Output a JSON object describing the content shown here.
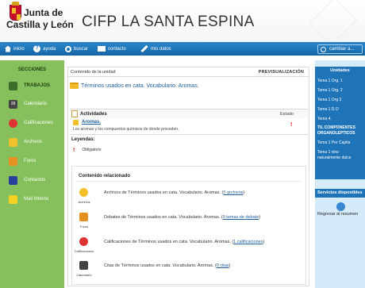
{
  "header": {
    "logo_line1": "Junta de",
    "logo_line2": "Castilla y León",
    "site_title": "CIFP LA SANTA ESPINA"
  },
  "nav": {
    "inicio": "inicio",
    "ayuda": "ayuda",
    "buscar": "buscar",
    "contacto": "contacto",
    "mis_datos": "mis datos",
    "cambiar": "cambiar a..."
  },
  "sidebar": {
    "title": "SECCIONES",
    "items": [
      {
        "label": "TRABAJOS",
        "icon": "works-icon"
      },
      {
        "label": "Calendario",
        "icon": "calendar-icon",
        "badge": "28"
      },
      {
        "label": "Calificaciones",
        "icon": "grades-icon"
      },
      {
        "label": "Archivos",
        "icon": "files-icon"
      },
      {
        "label": "Foros",
        "icon": "forums-icon"
      },
      {
        "label": "Contactos",
        "icon": "contacts-icon"
      },
      {
        "label": "Mail Interno",
        "icon": "mail-icon"
      }
    ]
  },
  "main": {
    "unit_label": "Contenido de la unidad",
    "preview_label": "PREVISUALIZACIÓN",
    "unit_title": "Términos usados en cata. Vocabulario. Aromas.",
    "activities": {
      "title": "Actividades",
      "status_header": "Estado",
      "items": [
        {
          "name": "Aromas.",
          "description": "Los aromas y los compuestos químicos de donde proceden.",
          "flag": "!"
        }
      ]
    },
    "legends": {
      "title": "Leyendas:",
      "items": [
        {
          "flag": "!",
          "text": "Obligatorio"
        }
      ]
    },
    "related": {
      "title": "Contenido relacionado",
      "rows": [
        {
          "caption": "Archivos",
          "text": "Archivos de Términos usados en cata. Vocabulario. Aromas. (",
          "link": "0 archivos",
          "suffix": ")"
        },
        {
          "caption": "Foros",
          "text": "Debates de Términos usados en cata. Vocabulario. Aromas. (",
          "link": "0 temas de debate",
          "suffix": ")"
        },
        {
          "caption": "Calificaciones",
          "text": "Calificaciones de Términos usados en cata. Vocabulario. Aromas. (",
          "link": "1 calificaciones",
          "suffix": ")"
        },
        {
          "caption": "Calendario",
          "text": "Citas de Términos usados en cata. Vocabulario. Aromas. (",
          "link": "0 citas",
          "suffix": ")"
        }
      ]
    }
  },
  "rightbar": {
    "units_title": "Unidades",
    "units": [
      "Tema 1 Org. 1",
      "Tema 1 Org. 2",
      "Tema 1 Org 3",
      "Tema 1 D.O",
      "Tema 4.",
      "TIL COMPONENTES",
      "ORGANOLÉPTICOS",
      "Tema 1 Per Capita",
      "Tema 1 vino",
      "naturalmente dulce"
    ],
    "active_unit": "TIL COMPONENTES",
    "services_title": "Servicios disponibles",
    "services_link": "Regresar al resumen"
  },
  "colors": {
    "nav_blue": "#1f74b8",
    "sidebar_green": "#86c05d",
    "right_panel": "#d6ebfa",
    "link_blue": "#1c5d9c",
    "required_red": "#d01010"
  }
}
